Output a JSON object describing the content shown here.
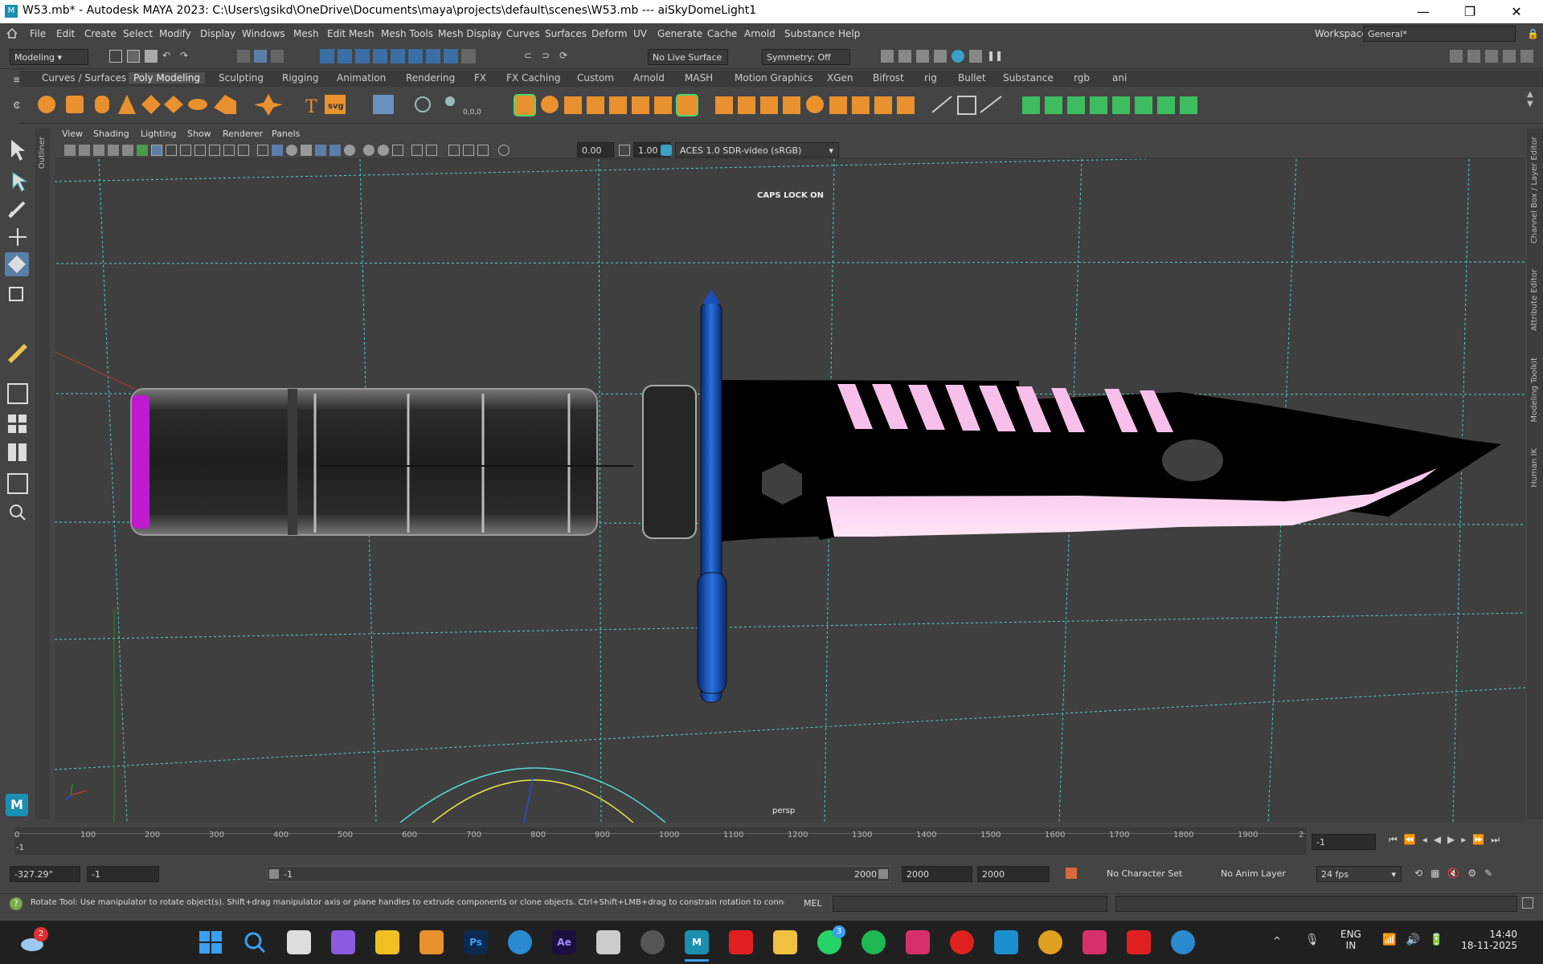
{
  "window": {
    "title": "W53.mb* - Autodesk MAYA 2023: C:\\Users\\gsikd\\OneDrive\\Documents\\maya\\projects\\default\\scenes\\W53.mb   ---   aiSkyDomeLight1",
    "minimize": "—",
    "maximize": "❐",
    "close": "✕"
  },
  "menubar": {
    "items": [
      "File",
      "Edit",
      "Create",
      "Select",
      "Modify",
      "Display",
      "Windows",
      "Mesh",
      "Edit Mesh",
      "Mesh Tools",
      "Mesh Display",
      "Curves",
      "Surfaces",
      "Deform",
      "UV",
      "Generate",
      "Cache",
      "Arnold",
      "Substance",
      "Help"
    ],
    "workspace_label": "Workspace:",
    "workspace_value": "General*"
  },
  "statusline": {
    "mode": "Modeling",
    "live_surface": "No Live Surface",
    "symmetry": "Symmetry: Off"
  },
  "shelf_tabs": [
    "Curves / Surfaces",
    "Poly Modeling",
    "Sculpting",
    "Rigging",
    "Animation",
    "Rendering",
    "FX",
    "FX Caching",
    "Custom",
    "Arnold",
    "MASH",
    "Motion Graphics",
    "XGen",
    "Bifrost",
    "rig",
    "Bullet",
    "Substance",
    "rgb",
    "ani"
  ],
  "shelf_text": {
    "svg": "svg",
    "coord": "0,0,0"
  },
  "side_panels": {
    "outliner": "Outliner",
    "right": [
      "Channel Box / Layer Editor",
      "Attribute Editor",
      "Modeling Toolkit",
      "Human IK"
    ]
  },
  "panel_menu": [
    "View",
    "Shading",
    "Lighting",
    "Show",
    "Renderer",
    "Panels"
  ],
  "panel_bar": {
    "exposure": "0.00",
    "gamma": "1.00",
    "colorspace": "ACES 1.0 SDR-video (sRGB)"
  },
  "viewport": {
    "caps_lock": "CAPS LOCK ON",
    "camera": "persp"
  },
  "timeline": {
    "ticks": [
      "0",
      "100",
      "200",
      "300",
      "400",
      "500",
      "600",
      "700",
      "800",
      "900",
      "1000",
      "1100",
      "1200",
      "1300",
      "1400",
      "1500",
      "1600",
      "1700",
      "1800",
      "1900",
      "2"
    ],
    "current_frame_marker": "-1",
    "current_frame_field": "-1"
  },
  "range": {
    "rotation_field": "-327.29°",
    "start_field": "-1",
    "slider_start": "-1",
    "slider_end": "2000",
    "end_field": "2000",
    "anim_end_field": "2000",
    "character_set": "No Character Set",
    "anim_layer": "No Anim Layer",
    "fps": "24 fps"
  },
  "help": {
    "text": "Rotate Tool: Use manipulator to rotate object(s). Shift+drag manipulator axis or plane handles to extrude components or clone objects. Ctrl+Shift+LMB+drag to constrain rotation to connected edges. Use D or INSE",
    "mel_label": "MEL"
  },
  "taskbar": {
    "weather_badge": "2",
    "whatsapp_badge": "3",
    "lang_top": "ENG",
    "lang_bottom": "IN",
    "time": "14:40",
    "date": "18-11-2025",
    "ps": "Ps",
    "ae": "Ae",
    "maya": "M"
  },
  "colors": {
    "accent_pink": "#f7c0ea",
    "handle_magenta": "#c01ad0",
    "guard_blue": "#1a4fb8",
    "grid_line": "#4fd6c6"
  }
}
